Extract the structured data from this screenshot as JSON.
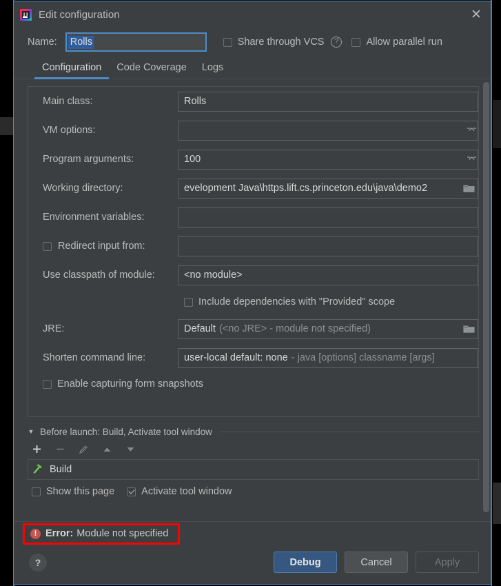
{
  "window": {
    "title": "Edit configuration",
    "app_icon": "intellij-idea-icon",
    "close_icon": "close-icon"
  },
  "name_row": {
    "label": "Name:",
    "value": "Rolls",
    "share_vcs_label": "Share through VCS",
    "share_vcs_checked": false,
    "help_icon": "question-mark-icon",
    "allow_parallel_label": "Allow parallel run",
    "allow_parallel_checked": false
  },
  "tabs": [
    {
      "label": "Configuration",
      "active": true
    },
    {
      "label": "Code Coverage",
      "active": false
    },
    {
      "label": "Logs",
      "active": false
    }
  ],
  "form": {
    "main_class": {
      "label": "Main class:",
      "value": "Rolls"
    },
    "vm_options": {
      "label": "VM options:",
      "value": "",
      "expand_icon": "expand-field-icon"
    },
    "program_arguments": {
      "label": "Program arguments:",
      "value": "100",
      "expand_icon": "expand-field-icon"
    },
    "working_directory": {
      "label": "Working directory:",
      "value": "evelopment Java\\https.lift.cs.princeton.edu\\java\\demo2",
      "browse_icon": "folder-icon"
    },
    "environment_variables": {
      "label": "Environment variables:",
      "value": ""
    },
    "redirect_input": {
      "label": "Redirect input from:",
      "value": "",
      "checked": false
    },
    "use_classpath": {
      "label": "Use classpath of module:",
      "value": "<no module>"
    },
    "include_dependencies": {
      "label": "Include dependencies with \"Provided\" scope",
      "checked": false
    },
    "jre": {
      "label": "JRE:",
      "value": "Default",
      "value_hint": "(<no JRE> - module not specified)",
      "browse_icon": "folder-icon"
    },
    "shorten_command_line": {
      "label": "Shorten command line:",
      "value": "user-local default: none",
      "value_hint": "- java [options] classname [args]"
    },
    "enable_snapshots": {
      "label": "Enable capturing form snapshots",
      "checked": false
    }
  },
  "before_launch": {
    "caret_icon": "chevron-down-icon",
    "title": "Before launch: Build, Activate tool window",
    "toolbar": [
      {
        "name": "add-button",
        "glyph": "+",
        "enabled": true
      },
      {
        "name": "remove-button",
        "glyph": "−",
        "enabled": false
      },
      {
        "name": "edit-button",
        "glyph": "pencil-icon",
        "enabled": false
      },
      {
        "name": "move-up-button",
        "glyph": "▲",
        "enabled": false
      },
      {
        "name": "move-down-button",
        "glyph": "▼",
        "enabled": false
      }
    ],
    "items": [
      {
        "label": "Build",
        "icon": "hammer-icon",
        "icon_color": "#6fbf53"
      }
    ],
    "show_this_page": {
      "label": "Show this page",
      "checked": false
    },
    "activate_tool_window": {
      "label": "Activate tool window",
      "checked": true
    }
  },
  "error": {
    "icon": "error-icon",
    "strong": "Error:",
    "message": "Module not specified",
    "highlight_color": "#ff0000"
  },
  "buttons": {
    "help": "?",
    "debug": "Debug",
    "cancel": "Cancel",
    "apply": "Apply"
  }
}
